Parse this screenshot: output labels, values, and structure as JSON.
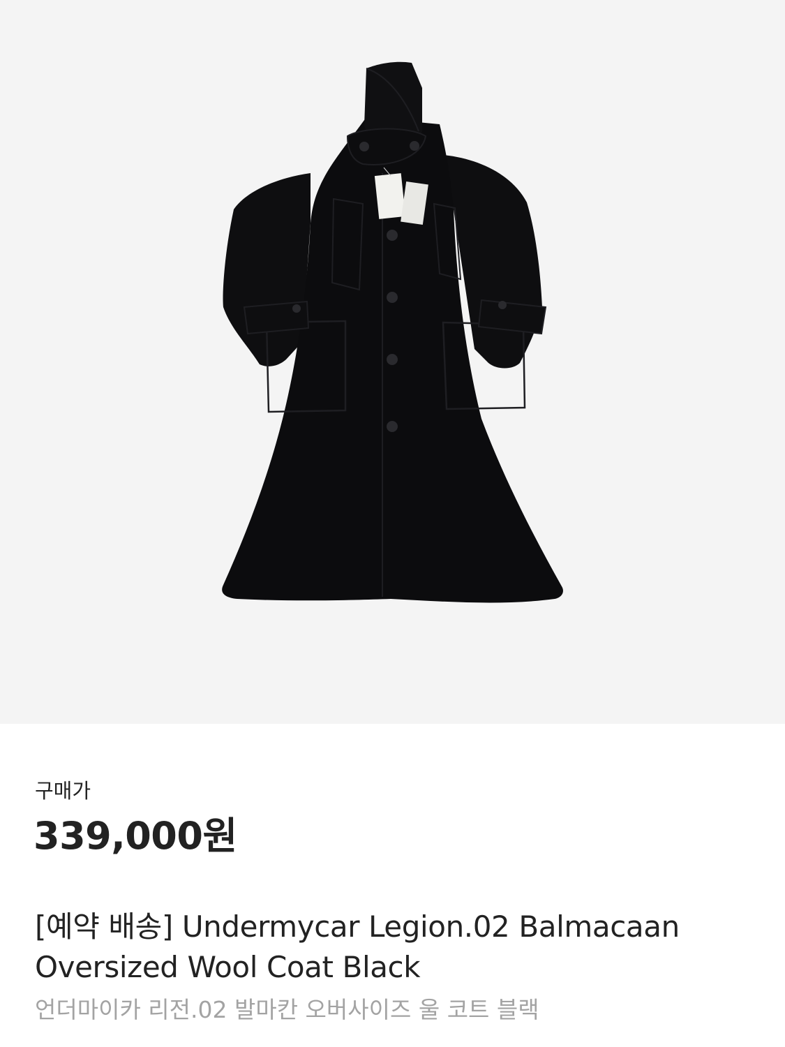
{
  "product": {
    "image": {
      "alt": "Undermycar Legion.02 Balmacaan Oversized Wool Coat Black",
      "background": "#f4f4f4",
      "coat_color": "#0c0c0e"
    },
    "price_label": "구매가",
    "price": "339,000원",
    "title_line1": "[예약 배송] Undermycar Legion.02 Balmacaan",
    "title_line2": "Oversized Wool Coat Black",
    "subtitle": "언더마이카 리전.02 발마칸 오버사이즈 울 코트 블랙"
  }
}
